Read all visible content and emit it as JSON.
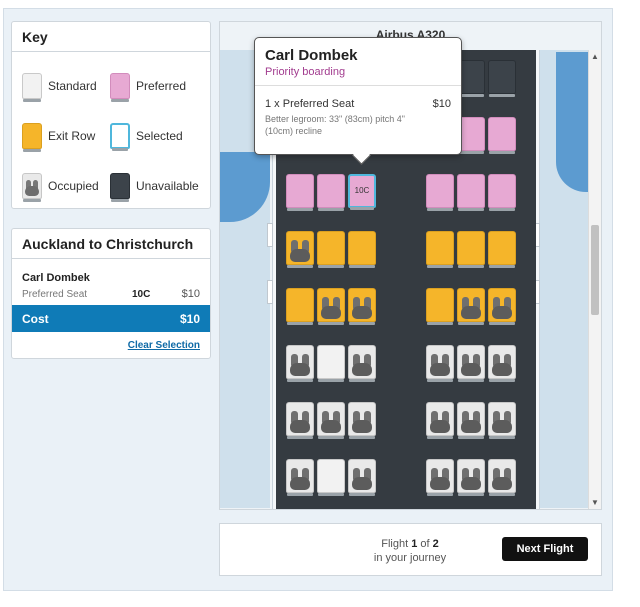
{
  "key": {
    "title": "Key",
    "items": [
      {
        "label": "Standard",
        "type": "standard"
      },
      {
        "label": "Preferred",
        "type": "preferred"
      },
      {
        "label": "Exit Row",
        "type": "exit"
      },
      {
        "label": "Selected",
        "type": "selected"
      },
      {
        "label": "Occupied",
        "type": "occupied"
      },
      {
        "label": "Unavailable",
        "type": "unavailable"
      }
    ]
  },
  "route": {
    "title": "Auckland to Christchurch",
    "passenger_name": "Carl Dombek",
    "seat_type": "Preferred Seat",
    "seat_number": "10C",
    "seat_price": "$10",
    "cost_label": "Cost",
    "cost_value": "$10",
    "clear_label": "Clear Selection"
  },
  "seatmap": {
    "aircraft": "Airbus A320",
    "selected_seat_label": "10C",
    "rows": [
      {
        "kind": "unavailable",
        "seats": [
          "u",
          "u",
          "u",
          "u",
          "u",
          "u"
        ],
        "partial": true
      },
      {
        "kind": "preferred",
        "seats": [
          "p",
          "p",
          "p",
          "p",
          "p",
          "p"
        ]
      },
      {
        "kind": "preferred",
        "seats": [
          "p",
          "p",
          "sel",
          "p",
          "p",
          "p"
        ]
      },
      {
        "kind": "exit",
        "seats": [
          "eo",
          "e",
          "e",
          "e",
          "e",
          "e"
        ]
      },
      {
        "kind": "exit",
        "seats": [
          "e",
          "eo",
          "eo",
          "e",
          "eo",
          "eo"
        ]
      },
      {
        "kind": "standard",
        "seats": [
          "o",
          "s",
          "o",
          "o",
          "o",
          "o"
        ]
      },
      {
        "kind": "standard",
        "seats": [
          "o",
          "o",
          "o",
          "o",
          "o",
          "o"
        ]
      },
      {
        "kind": "standard",
        "seats": [
          "o",
          "s",
          "o",
          "o",
          "o",
          "o"
        ]
      }
    ]
  },
  "tooltip": {
    "name": "Carl Dombek",
    "subtitle": "Priority boarding",
    "item": "1 x Preferred Seat",
    "price": "$10",
    "description": "Better legroom: 33\" (83cm) pitch 4\" (10cm) recline"
  },
  "footer": {
    "flight_prefix": "Flight",
    "flight_current": "1",
    "flight_of": "of",
    "flight_total": "2",
    "flight_suffix": "in your journey",
    "next_label": "Next Flight"
  },
  "colors": {
    "accent": "#0f7bb7",
    "preferred": "#e7a9d3",
    "exit": "#f5b52a",
    "selected_border": "#4fb7dc",
    "unavailable": "#3c434a"
  }
}
